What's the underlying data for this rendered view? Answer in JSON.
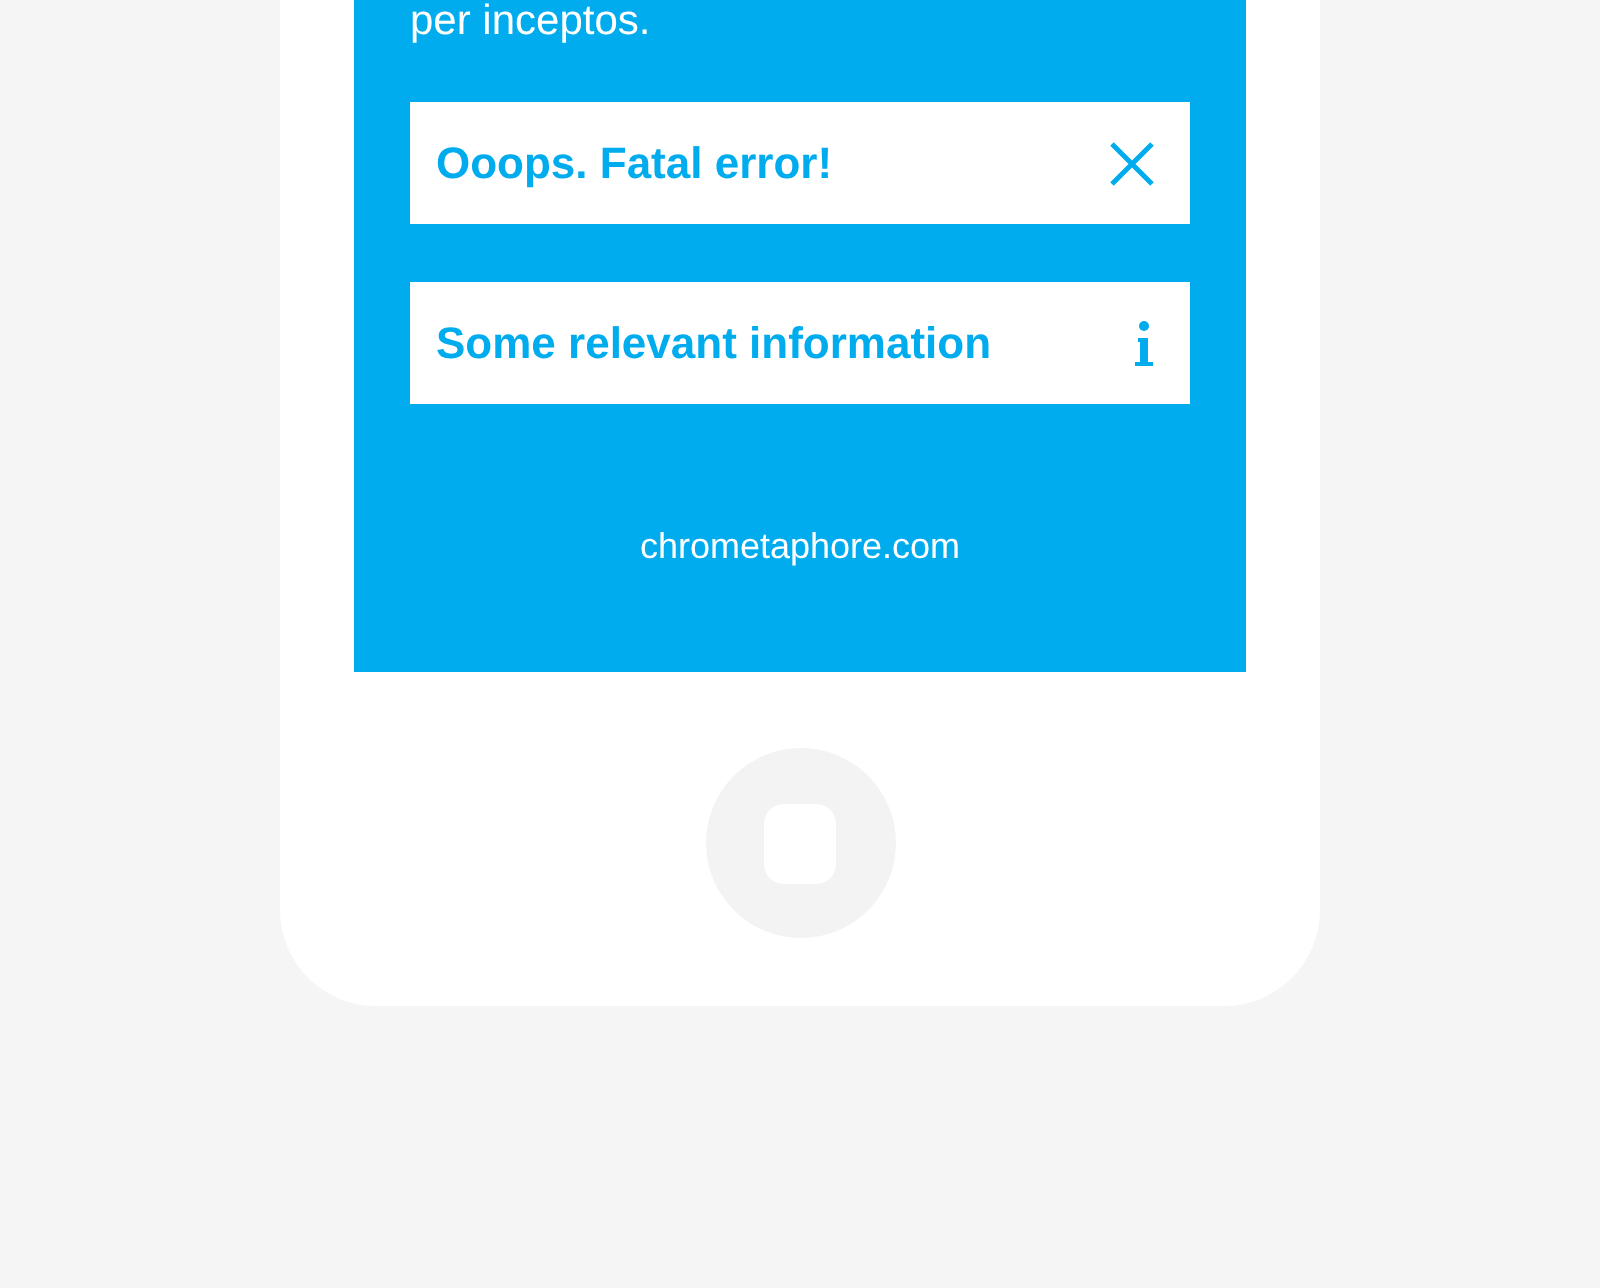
{
  "screen": {
    "intro_text": "per inceptos.",
    "alerts": [
      {
        "kind": "error",
        "text": "Ooops. Fatal error!"
      },
      {
        "kind": "info",
        "text": "Some relevant information"
      }
    ],
    "footer_link": "chrometaphore.com"
  }
}
